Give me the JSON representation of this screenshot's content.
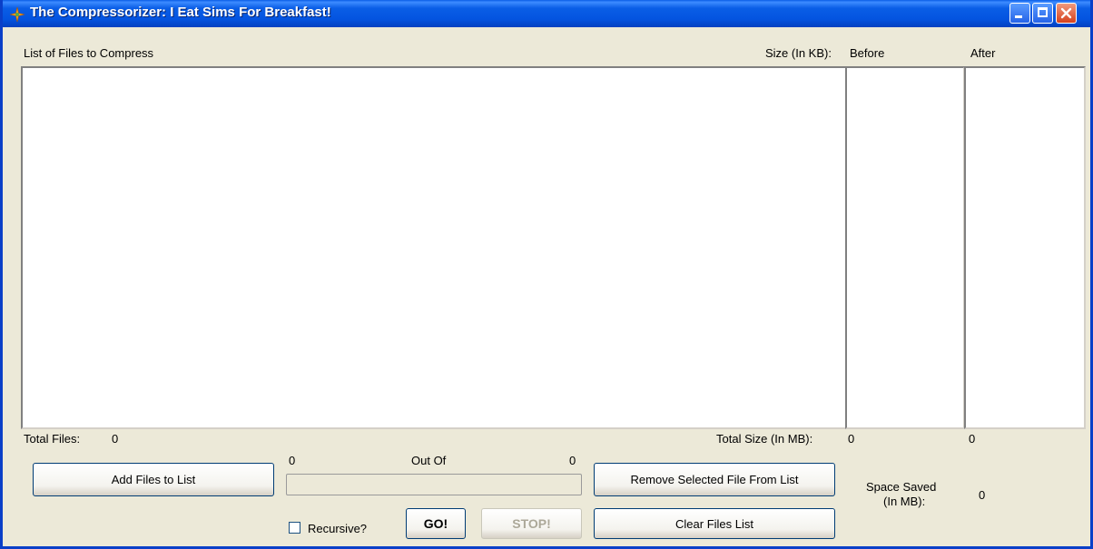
{
  "window": {
    "title": "The Compressorizer: I Eat Sims For Breakfast!"
  },
  "headers": {
    "files": "List of Files to Compress",
    "size": "Size (In KB):",
    "before": "Before",
    "after": "After"
  },
  "totals": {
    "files_label": "Total Files:",
    "files_value": "0",
    "size_label": "Total Size (In MB):",
    "size_before": "0",
    "size_after": "0"
  },
  "progress": {
    "current": "0",
    "out_of_label": "Out Of",
    "total": "0",
    "fraction": 0
  },
  "buttons": {
    "add": "Add Files to List",
    "remove": "Remove Selected File From List",
    "clear": "Clear Files List",
    "go": "GO!",
    "stop": "STOP!"
  },
  "options": {
    "recursive_label": "Recursive?",
    "recursive_checked": false
  },
  "space_saved": {
    "label_line1": "Space Saved",
    "label_line2": "(In MB):",
    "value": "0"
  }
}
